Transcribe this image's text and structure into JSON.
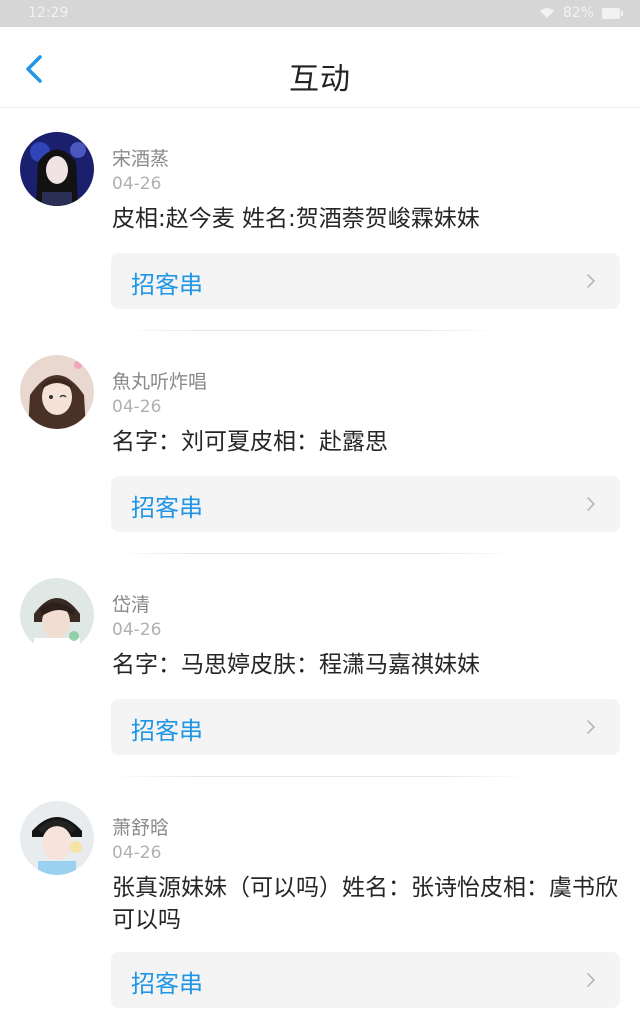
{
  "status_bar": {
    "time": "12:29",
    "battery": "82%"
  },
  "header": {
    "title": "互动"
  },
  "posts": [
    {
      "name": "宋酒蒸",
      "date": "04-26",
      "text": "皮相:赵今麦 姓名:贺酒萘贺峻霖妹妹",
      "link": "招客串"
    },
    {
      "name": "魚丸听炸唱",
      "date": "04-26",
      "text": "名字：刘可夏皮相：赴露思",
      "link": "招客串"
    },
    {
      "name": "岱清",
      "date": "04-26",
      "text": "名字：马思婷皮肤：程潇马嘉祺妹妹",
      "link": "招客串"
    },
    {
      "name": "萧舒晗",
      "date": "04-26",
      "text": "张真源妹妹（可以吗）姓名：张诗怡皮相：虞书欣可以吗",
      "link": "招客串"
    }
  ]
}
